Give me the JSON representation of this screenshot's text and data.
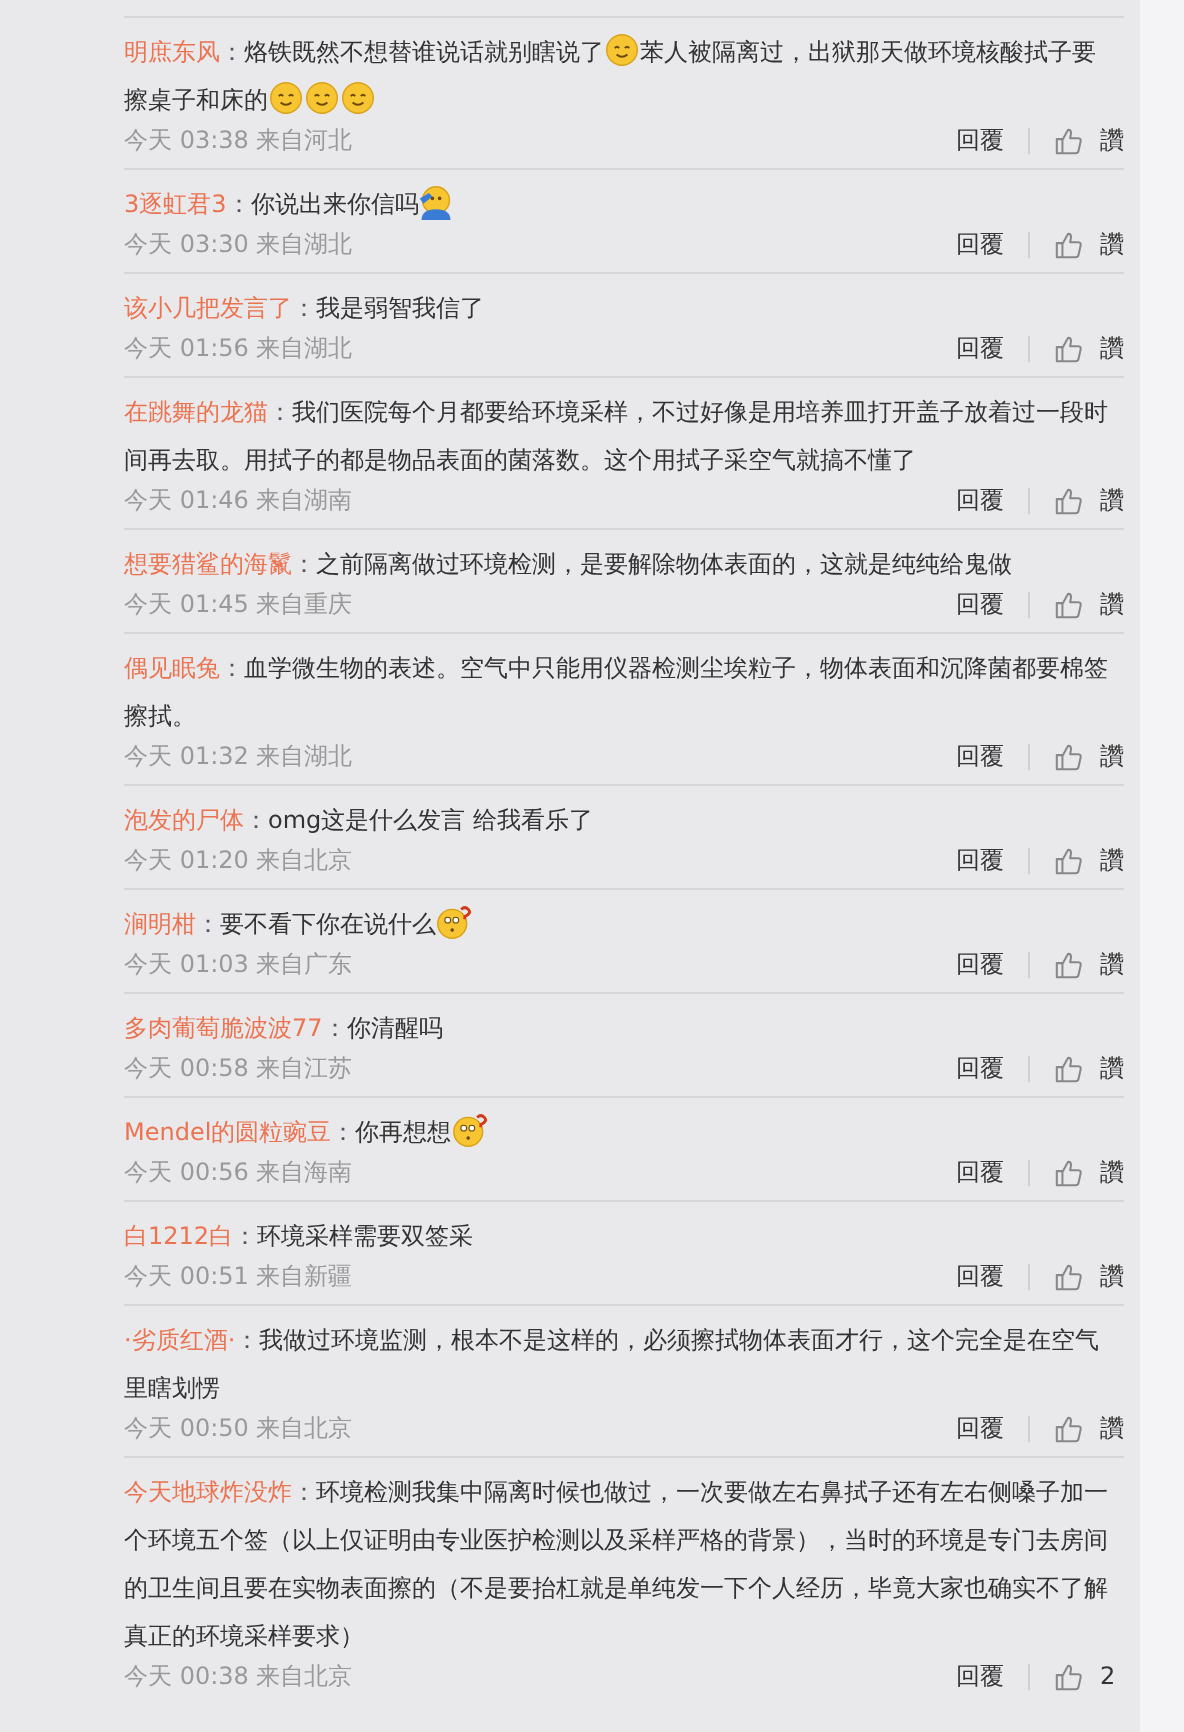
{
  "comments": [
    {
      "name": "明庶东风",
      "colon": "：",
      "segments": [
        {
          "kind": "text",
          "text": "烙铁既然不想替谁说话就别瞎说了"
        },
        {
          "kind": "smile"
        },
        {
          "kind": "text",
          "text": "苯人被隔离过，出狱那天做环境核酸拭子要擦桌子和床的"
        },
        {
          "kind": "smile"
        },
        {
          "kind": "smile"
        },
        {
          "kind": "smile"
        }
      ],
      "time": "今天 03:38 来自河北",
      "reply": "回覆",
      "like": "讚"
    },
    {
      "name": "3逐虹君3",
      "colon": "：",
      "segments": [
        {
          "kind": "text",
          "text": "你说出来你信吗"
        },
        {
          "kind": "salute"
        }
      ],
      "time": "今天 03:30 来自湖北",
      "reply": "回覆",
      "like": "讚"
    },
    {
      "name": "该小几把发言了",
      "colon": "：",
      "segments": [
        {
          "kind": "text",
          "text": "我是弱智我信了"
        }
      ],
      "time": "今天 01:56 来自湖北",
      "reply": "回覆",
      "like": "讚"
    },
    {
      "name": "在跳舞的龙猫",
      "colon": "：",
      "segments": [
        {
          "kind": "text",
          "text": "我们医院每个月都要给环境采样，不过好像是用培养皿打开盖子放着过一段时间再去取。用拭子的都是物品表面的菌落数。这个用拭子采空气就搞不懂了"
        }
      ],
      "time": "今天 01:46 来自湖南",
      "reply": "回覆",
      "like": "讚"
    },
    {
      "name": "想要猎鲨的海鬣",
      "colon": "：",
      "segments": [
        {
          "kind": "text",
          "text": "之前隔离做过环境检测，是要解除物体表面的，这就是纯纯给鬼做"
        }
      ],
      "time": "今天 01:45 来自重庆",
      "reply": "回覆",
      "like": "讚"
    },
    {
      "name": "偶见眠兔",
      "colon": "：",
      "segments": [
        {
          "kind": "text",
          "text": "血学微生物的表述。空气中只能用仪器检测尘埃粒子，物体表面和沉降菌都要棉签擦拭。"
        }
      ],
      "time": "今天 01:32 来自湖北",
      "reply": "回覆",
      "like": "讚"
    },
    {
      "name": "泡发的尸体",
      "colon": "：",
      "segments": [
        {
          "kind": "text",
          "text": "omg这是什么发言 给我看乐了"
        }
      ],
      "time": "今天 01:20 来自北京",
      "reply": "回覆",
      "like": "讚"
    },
    {
      "name": "涧明柑",
      "colon": "：",
      "segments": [
        {
          "kind": "text",
          "text": "要不看下你在说什么"
        },
        {
          "kind": "puzzled"
        }
      ],
      "time": "今天 01:03 来自广东",
      "reply": "回覆",
      "like": "讚"
    },
    {
      "name": "多肉葡萄脆波波77",
      "colon": "：",
      "segments": [
        {
          "kind": "text",
          "text": "你清醒吗"
        }
      ],
      "time": "今天 00:58 来自江苏",
      "reply": "回覆",
      "like": "讚"
    },
    {
      "name": "Mendel的圆粒豌豆",
      "colon": "：",
      "segments": [
        {
          "kind": "text",
          "text": "你再想想"
        },
        {
          "kind": "puzzled"
        }
      ],
      "time": "今天 00:56 来自海南",
      "reply": "回覆",
      "like": "讚"
    },
    {
      "name": "白1212白",
      "colon": "：",
      "segments": [
        {
          "kind": "text",
          "text": "环境采样需要双签采"
        }
      ],
      "time": "今天 00:51 来自新疆",
      "reply": "回覆",
      "like": "讚"
    },
    {
      "name": "·劣质红酒·",
      "colon": "：",
      "segments": [
        {
          "kind": "text",
          "text": "我做过环境监测，根本不是这样的，必须擦拭物体表面才行，这个完全是在空气里瞎划愣"
        }
      ],
      "time": "今天 00:50 来自北京",
      "reply": "回覆",
      "like": "讚"
    },
    {
      "name": "今天地球炸没炸",
      "colon": "：",
      "segments": [
        {
          "kind": "text",
          "text": "环境检测我集中隔离时候也做过，一次要做左右鼻拭子还有左右侧嗓子加一个环境五个签（以上仅证明由专业医护检测以及采样严格的背景），当时的环境是专门去房间的卫生间且要在实物表面擦的（不是要抬杠就是单纯发一下个人经历，毕竟大家也确实不了解真正的环境采样要求）"
        }
      ],
      "time": "今天 00:38 来自北京",
      "reply": "回覆",
      "like": "2"
    }
  ]
}
